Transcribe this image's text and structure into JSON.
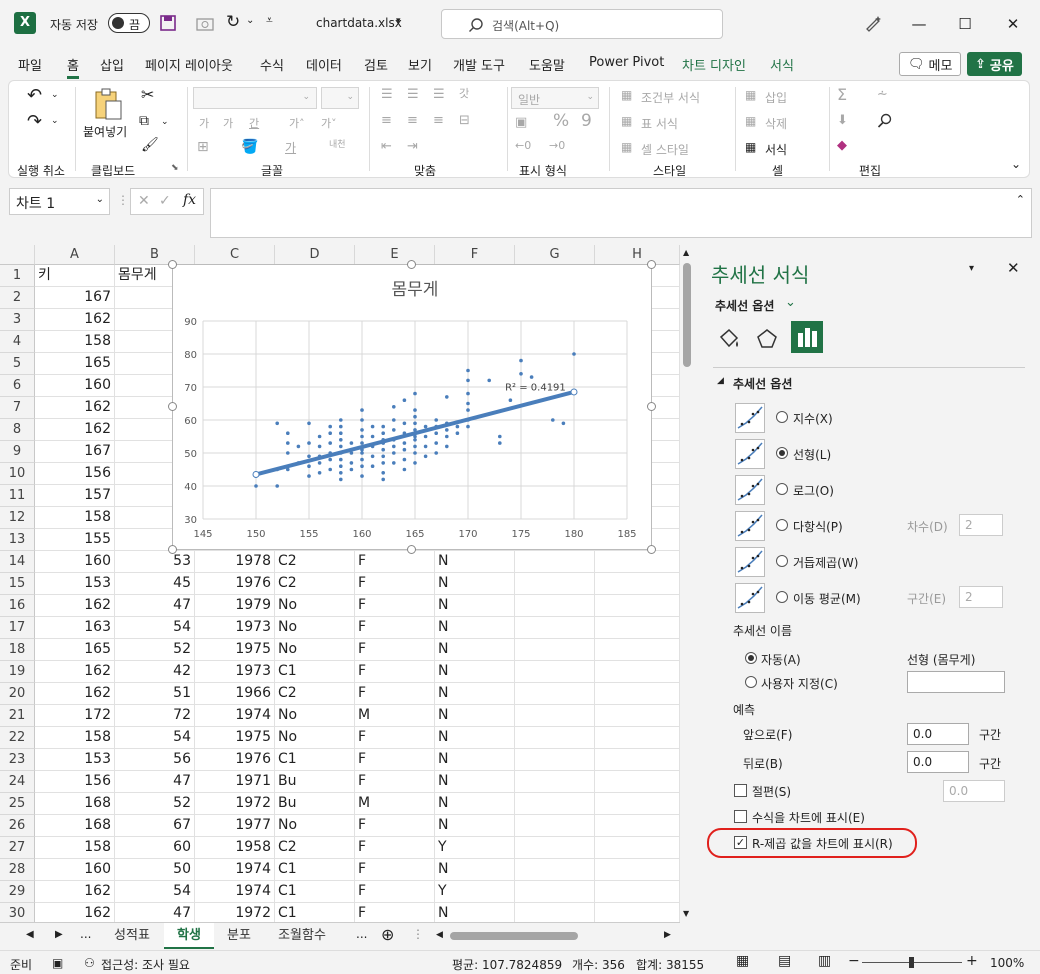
{
  "titlebar": {
    "autosave_label": "자동 저장",
    "autosave_state": "끔",
    "filename": "chartdata.xlsx",
    "search_placeholder": "검색(Alt+Q)"
  },
  "menu": {
    "tabs": [
      {
        "label": "파일"
      },
      {
        "label": "홈"
      },
      {
        "label": "삽입"
      },
      {
        "label": "페이지 레이아웃"
      },
      {
        "label": "수식"
      },
      {
        "label": "데이터"
      },
      {
        "label": "검토"
      },
      {
        "label": "보기"
      },
      {
        "label": "개발 도구"
      },
      {
        "label": "도움말"
      },
      {
        "label": "Power Pivot"
      },
      {
        "label": "차트 디자인"
      },
      {
        "label": "서식"
      }
    ],
    "memo_label": "메모",
    "share_label": "공유"
  },
  "ribbon": {
    "groups": {
      "undo": "실행 취소",
      "clipboard": "클립보드",
      "font": "글꼴",
      "align": "맞춤",
      "number": "표시 형식",
      "style": "스타일",
      "cells": "셀",
      "edit": "편집"
    },
    "paste_label": "붙여넣기",
    "number_format_value": "일반",
    "wrap_label": "내천",
    "style_items": [
      "조건부 서식",
      "표 서식",
      "셀 스타일"
    ],
    "cell_items": [
      "삽입",
      "삭제",
      "서식"
    ]
  },
  "formula_bar": {
    "name_box": "차트 1",
    "fx": "fx"
  },
  "grid": {
    "columns": [
      "A",
      "B",
      "C",
      "D",
      "E",
      "F",
      "G",
      "H"
    ],
    "header_row": {
      "num": "1",
      "a": "키",
      "b": "몸무게"
    },
    "top_rows": [
      {
        "num": "2",
        "a": "167"
      },
      {
        "num": "3",
        "a": "162"
      },
      {
        "num": "4",
        "a": "158"
      },
      {
        "num": "5",
        "a": "165"
      },
      {
        "num": "6",
        "a": "160"
      },
      {
        "num": "7",
        "a": "162"
      },
      {
        "num": "8",
        "a": "162"
      },
      {
        "num": "9",
        "a": "167"
      },
      {
        "num": "10",
        "a": "156"
      },
      {
        "num": "11",
        "a": "157"
      },
      {
        "num": "12",
        "a": "158"
      },
      {
        "num": "13",
        "a": "155"
      }
    ],
    "rows": [
      {
        "num": "14",
        "a": "160",
        "b": "53",
        "c": "1978",
        "d": "C2",
        "e": "F",
        "f": "N"
      },
      {
        "num": "15",
        "a": "153",
        "b": "45",
        "c": "1976",
        "d": "C2",
        "e": "F",
        "f": "N"
      },
      {
        "num": "16",
        "a": "162",
        "b": "47",
        "c": "1979",
        "d": "No",
        "e": "F",
        "f": "N"
      },
      {
        "num": "17",
        "a": "163",
        "b": "54",
        "c": "1973",
        "d": "No",
        "e": "F",
        "f": "N"
      },
      {
        "num": "18",
        "a": "165",
        "b": "52",
        "c": "1975",
        "d": "No",
        "e": "F",
        "f": "N"
      },
      {
        "num": "19",
        "a": "162",
        "b": "42",
        "c": "1973",
        "d": "C1",
        "e": "F",
        "f": "N"
      },
      {
        "num": "20",
        "a": "162",
        "b": "51",
        "c": "1966",
        "d": "C2",
        "e": "F",
        "f": "N"
      },
      {
        "num": "21",
        "a": "172",
        "b": "72",
        "c": "1974",
        "d": "No",
        "e": "M",
        "f": "N"
      },
      {
        "num": "22",
        "a": "158",
        "b": "54",
        "c": "1975",
        "d": "No",
        "e": "F",
        "f": "N"
      },
      {
        "num": "23",
        "a": "153",
        "b": "56",
        "c": "1976",
        "d": "C1",
        "e": "F",
        "f": "N"
      },
      {
        "num": "24",
        "a": "156",
        "b": "47",
        "c": "1971",
        "d": "Bu",
        "e": "F",
        "f": "N"
      },
      {
        "num": "25",
        "a": "168",
        "b": "52",
        "c": "1972",
        "d": "Bu",
        "e": "M",
        "f": "N"
      },
      {
        "num": "26",
        "a": "168",
        "b": "67",
        "c": "1977",
        "d": "No",
        "e": "F",
        "f": "N"
      },
      {
        "num": "27",
        "a": "158",
        "b": "60",
        "c": "1958",
        "d": "C2",
        "e": "F",
        "f": "Y"
      },
      {
        "num": "28",
        "a": "160",
        "b": "50",
        "c": "1974",
        "d": "C1",
        "e": "F",
        "f": "N"
      },
      {
        "num": "29",
        "a": "162",
        "b": "54",
        "c": "1974",
        "d": "C1",
        "e": "F",
        "f": "Y"
      },
      {
        "num": "30",
        "a": "162",
        "b": "47",
        "c": "1972",
        "d": "C1",
        "e": "F",
        "f": "N"
      }
    ]
  },
  "chart_data": {
    "type": "scatter",
    "title": "몸무게",
    "xlim": [
      145,
      185
    ],
    "ylim": [
      30,
      90
    ],
    "xticks": [
      145,
      150,
      155,
      160,
      165,
      170,
      175,
      180,
      185
    ],
    "yticks": [
      30,
      40,
      50,
      60,
      70,
      80,
      90
    ],
    "grid": true,
    "trendline": {
      "type": "linear",
      "x": [
        150,
        180
      ],
      "y": [
        43.5,
        68.5
      ],
      "label": "R² = 0.4191",
      "color": "#4a7ebb"
    },
    "marker_color": "#4a7ebb",
    "points": [
      [
        150,
        40
      ],
      [
        150,
        43
      ],
      [
        152,
        40
      ],
      [
        152,
        45
      ],
      [
        152,
        59
      ],
      [
        153,
        45
      ],
      [
        153,
        50
      ],
      [
        153,
        53
      ],
      [
        153,
        56
      ],
      [
        154,
        47
      ],
      [
        154,
        52
      ],
      [
        155,
        43
      ],
      [
        155,
        46
      ],
      [
        155,
        49
      ],
      [
        155,
        53
      ],
      [
        155,
        59
      ],
      [
        156,
        44
      ],
      [
        156,
        47
      ],
      [
        156,
        49
      ],
      [
        156,
        52
      ],
      [
        156,
        55
      ],
      [
        157,
        45
      ],
      [
        157,
        48
      ],
      [
        157,
        50
      ],
      [
        157,
        53
      ],
      [
        157,
        56
      ],
      [
        157,
        58
      ],
      [
        158,
        42
      ],
      [
        158,
        44
      ],
      [
        158,
        46
      ],
      [
        158,
        48
      ],
      [
        158,
        50
      ],
      [
        158,
        52
      ],
      [
        158,
        54
      ],
      [
        158,
        56
      ],
      [
        158,
        58
      ],
      [
        158,
        60
      ],
      [
        159,
        45
      ],
      [
        159,
        47
      ],
      [
        159,
        50
      ],
      [
        159,
        53
      ],
      [
        160,
        43
      ],
      [
        160,
        46
      ],
      [
        160,
        48
      ],
      [
        160,
        50
      ],
      [
        160,
        51
      ],
      [
        160,
        53
      ],
      [
        160,
        55
      ],
      [
        160,
        57
      ],
      [
        160,
        60
      ],
      [
        160,
        63
      ],
      [
        161,
        46
      ],
      [
        161,
        49
      ],
      [
        161,
        52
      ],
      [
        161,
        55
      ],
      [
        161,
        58
      ],
      [
        162,
        42
      ],
      [
        162,
        44
      ],
      [
        162,
        47
      ],
      [
        162,
        49
      ],
      [
        162,
        51
      ],
      [
        162,
        53
      ],
      [
        162,
        54
      ],
      [
        162,
        56
      ],
      [
        162,
        58
      ],
      [
        163,
        47
      ],
      [
        163,
        50
      ],
      [
        163,
        52
      ],
      [
        163,
        54
      ],
      [
        163,
        57
      ],
      [
        163,
        60
      ],
      [
        163,
        64
      ],
      [
        164,
        45
      ],
      [
        164,
        48
      ],
      [
        164,
        51
      ],
      [
        164,
        53
      ],
      [
        164,
        56
      ],
      [
        164,
        59
      ],
      [
        164,
        66
      ],
      [
        165,
        47
      ],
      [
        165,
        50
      ],
      [
        165,
        52
      ],
      [
        165,
        54
      ],
      [
        165,
        55
      ],
      [
        165,
        57
      ],
      [
        165,
        59
      ],
      [
        165,
        61
      ],
      [
        165,
        63
      ],
      [
        165,
        68
      ],
      [
        166,
        49
      ],
      [
        166,
        52
      ],
      [
        166,
        55
      ],
      [
        166,
        58
      ],
      [
        167,
        50
      ],
      [
        167,
        53
      ],
      [
        167,
        56
      ],
      [
        167,
        58
      ],
      [
        167,
        60
      ],
      [
        168,
        52
      ],
      [
        168,
        55
      ],
      [
        168,
        57
      ],
      [
        168,
        59
      ],
      [
        168,
        67
      ],
      [
        169,
        56
      ],
      [
        169,
        58
      ],
      [
        170,
        58
      ],
      [
        170,
        60
      ],
      [
        170,
        63
      ],
      [
        170,
        65
      ],
      [
        170,
        68
      ],
      [
        170,
        72
      ],
      [
        170,
        75
      ],
      [
        172,
        72
      ],
      [
        173,
        53
      ],
      [
        173,
        55
      ],
      [
        174,
        66
      ],
      [
        175,
        74
      ],
      [
        175,
        78
      ],
      [
        176,
        73
      ],
      [
        178,
        60
      ],
      [
        179,
        59
      ],
      [
        180,
        80
      ]
    ]
  },
  "pane": {
    "title": "추세선 서식",
    "subtitle": "추세선 옵션",
    "section": "추세선 옵션",
    "options": [
      {
        "label": "지수(X)",
        "checked": false
      },
      {
        "label": "선형(L)",
        "checked": true
      },
      {
        "label": "로그(O)",
        "checked": false
      },
      {
        "label": "다항식(P)",
        "checked": false,
        "extra_label": "차수(D)",
        "extra_value": "2"
      },
      {
        "label": "거듭제곱(W)",
        "checked": false
      },
      {
        "label": "이동 평균(M)",
        "checked": false,
        "extra_label": "구간(E)",
        "extra_value": "2"
      }
    ],
    "name_label": "추세선 이름",
    "auto_label": "자동(A)",
    "auto_value": "선형 (몸무게)",
    "custom_label": "사용자 지정(C)",
    "forecast_label": "예측",
    "forward_label": "앞으로(F)",
    "forward_value": "0.0",
    "backward_label": "뒤로(B)",
    "backward_value": "0.0",
    "period_unit": "구간",
    "intercept_label": "절편(S)",
    "intercept_value": "0.0",
    "equation_label": "수식을 차트에 표시(E)",
    "rsq_label": "R-제곱 값을 차트에 표시(R)",
    "rsq_checked": true
  },
  "sheets": {
    "tabs": [
      {
        "label": "성적표"
      },
      {
        "label": "학생"
      },
      {
        "label": "분포"
      },
      {
        "label": "조월함수"
      }
    ],
    "active_index": 1,
    "ellipsis": "..."
  },
  "status": {
    "ready": "준비",
    "accessibility": "접근성: 조사 필요",
    "average": "평균: 107.7824859",
    "count": "개수: 356",
    "sum": "합계: 38155",
    "zoom": "100%"
  }
}
